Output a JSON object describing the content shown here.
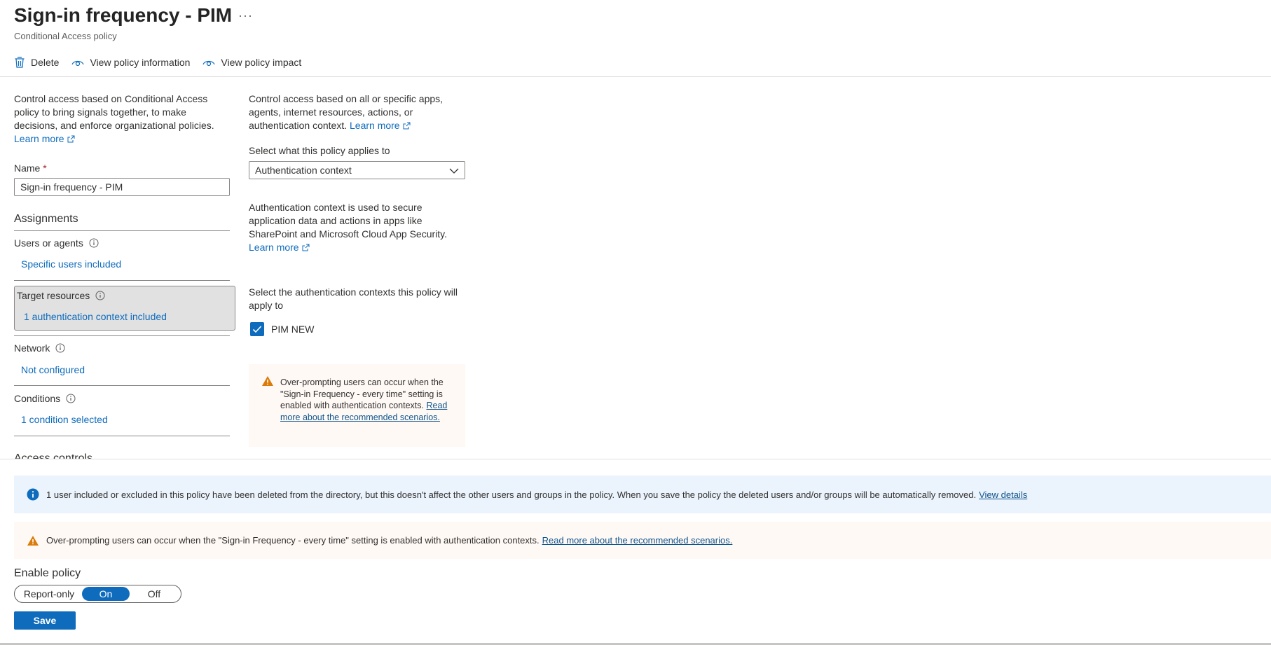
{
  "header": {
    "title": "Sign-in frequency - PIM",
    "more_label": "···",
    "subtitle": "Conditional Access policy"
  },
  "toolbar": {
    "delete_label": "Delete",
    "view_info_label": "View policy information",
    "view_impact_label": "View policy impact"
  },
  "left": {
    "description": "Control access based on Conditional Access policy to bring signals together, to make decisions, and enforce organizational policies.",
    "learn_more": "Learn more",
    "name_label": "Name",
    "required_mark": "*",
    "name_value": "Sign-in frequency - PIM",
    "assignments_heading": "Assignments",
    "users_label": "Users or agents",
    "users_value": "Specific users included",
    "target_label": "Target resources",
    "target_value": "1 authentication context included",
    "network_label": "Network",
    "network_value": "Not configured",
    "conditions_label": "Conditions",
    "conditions_value": "1 condition selected",
    "access_controls_heading": "Access controls"
  },
  "right": {
    "description": "Control access based on all or specific apps, agents, internet resources, actions, or authentication context.",
    "learn_more": "Learn more",
    "select_label": "Select what this policy applies to",
    "select_value": "Authentication context",
    "auth_desc": "Authentication context is used to secure application data and actions in apps like SharePoint and Microsoft Cloud App Security.",
    "auth_learn_more": "Learn more",
    "contexts_label": "Select the authentication contexts this policy will apply to",
    "context_item": "PIM NEW",
    "warning_text": "Over-prompting users can occur when the \"Sign-in Frequency - every time\" setting is enabled with authentication contexts.",
    "warning_link": "Read more about the recommended scenarios."
  },
  "banners": {
    "info_text": "1 user included or excluded in this policy have been deleted from the directory, but this doesn't affect the other users and groups in the policy. When you save the policy the deleted users and/or groups will be automatically removed.",
    "info_link": "View details",
    "warn_text": "Over-prompting users can occur when the \"Sign-in Frequency - every time\" setting is enabled with authentication contexts.",
    "warn_link": "Read more about the recommended scenarios."
  },
  "footer": {
    "enable_label": "Enable policy",
    "options": [
      "Report-only",
      "On",
      "Off"
    ],
    "selected": "On",
    "save_label": "Save"
  },
  "colors": {
    "accent": "#0f6cbd",
    "warning_icon": "#da7b0a",
    "info_bg": "#ebf3fc",
    "warning_bg": "#fff9f5"
  }
}
